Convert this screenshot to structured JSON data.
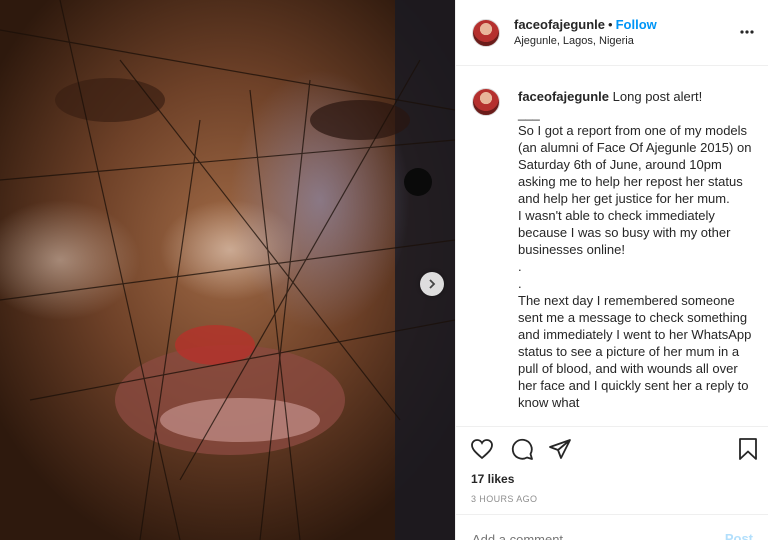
{
  "post": {
    "username": "faceofajegunle",
    "follow_label": "Follow",
    "separator": "•",
    "location": "Ajegunle, Lagos, Nigeria",
    "caption_username": "faceofajegunle",
    "caption_text": "Long post alert!\n___\nSo I got a report from one of my models (an alumni of Face Of Ajegunle 2015) on Saturday 6th of June, around 10pm asking me to help her repost her status and help her get justice for her mum.\nI wasn't able to check immediately because I was so busy with my other businesses online!\n.\n.\nThe next day I remembered someone sent me a message to check something and immediately I went to her WhatsApp status to see a picture of her mum in a pull of blood, and with wounds all over her face and I quickly sent her a reply to know what",
    "likes": "17 likes",
    "time": "3 HOURS AGO",
    "comment_placeholder": "Add a comment...",
    "post_label": "Post"
  },
  "icons": {
    "like": "heart-icon",
    "comment": "comment-icon",
    "share": "share-icon",
    "save": "bookmark-icon",
    "more": "more-options-icon",
    "next": "chevron-right-icon"
  },
  "colors": {
    "accent": "#0095f6",
    "text": "#262626",
    "muted": "#8e8e8e",
    "border": "#efefef"
  }
}
